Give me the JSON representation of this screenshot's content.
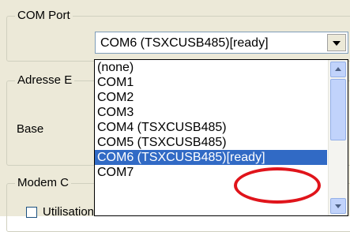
{
  "groups": {
    "com_port": {
      "title": "COM Port"
    },
    "adresse": {
      "title": "Adresse E",
      "base_label": "Base"
    },
    "modem": {
      "title": "Modem C",
      "checkbox_label": "Utilisation modem"
    }
  },
  "combo": {
    "selected_value": "COM6 (TSXCUSB485)[ready]"
  },
  "dropdown": {
    "items": [
      "(none)",
      "COM1",
      "COM2",
      "COM3",
      "COM4 (TSXCUSB485)",
      "COM5 (TSXCUSB485)",
      "COM6 (TSXCUSB485)[ready]",
      "COM7"
    ],
    "selected_index": 6
  },
  "colors": {
    "selection": "#316ac5",
    "annotation": "#e0141b"
  }
}
